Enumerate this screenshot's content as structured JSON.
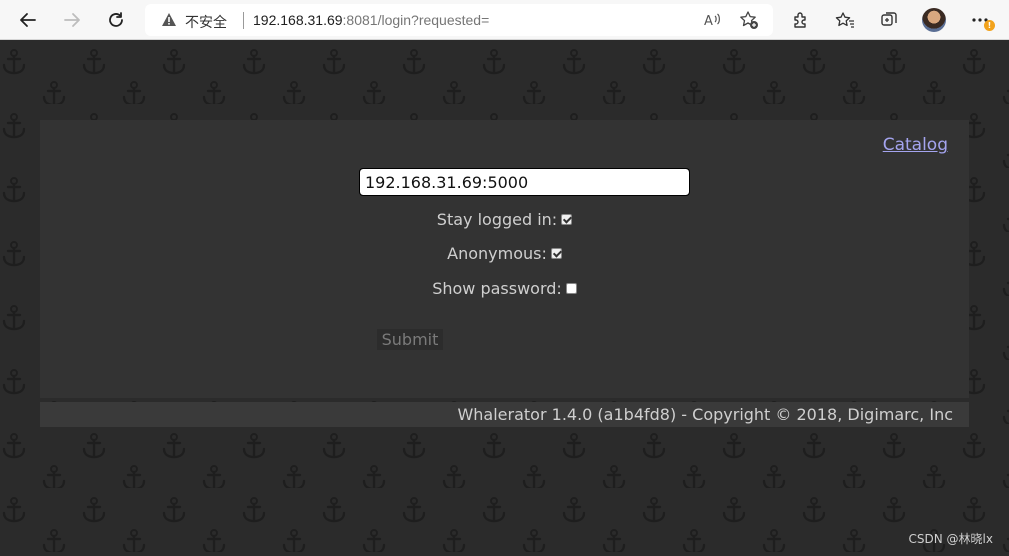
{
  "browser": {
    "security_label": "不安全",
    "url_host": "192.168.31.69",
    "url_rest": ":8081/login?requested="
  },
  "card": {
    "catalog_link": "Catalog",
    "server_value": "192.168.31.69:5000",
    "options": [
      {
        "label": "Stay logged in:",
        "checked": true
      },
      {
        "label": "Anonymous:",
        "checked": true
      },
      {
        "label": "Show password:",
        "checked": false
      }
    ],
    "submit_label": "Submit"
  },
  "footer": {
    "text": "Whalerator 1.4.0 (a1b4fd8) - Copyright © 2018, Digimarc, Inc"
  },
  "watermark": "CSDN @林晓lx",
  "colors": {
    "background": "#2b2b2b",
    "card": "#333333",
    "link": "#a4a4ef",
    "badge": "#f2a21b"
  }
}
